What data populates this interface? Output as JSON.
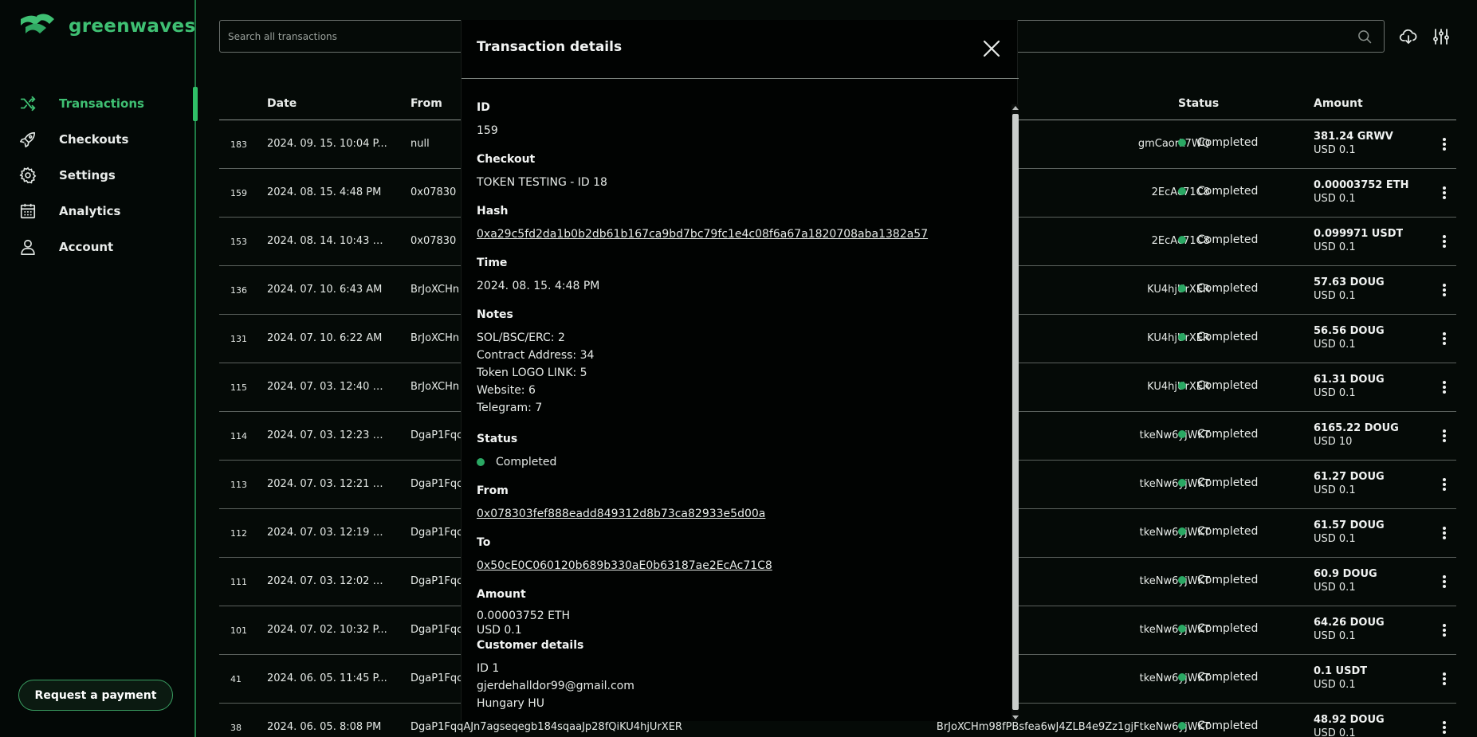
{
  "brand": {
    "name": "greenwaves"
  },
  "sidebar": {
    "items": [
      {
        "label": "Transactions",
        "icon": "shuffle-icon",
        "active": true
      },
      {
        "label": "Checkouts",
        "icon": "rocket-icon"
      },
      {
        "label": "Settings",
        "icon": "gear-icon"
      },
      {
        "label": "Analytics",
        "icon": "calendar-icon"
      },
      {
        "label": "Account",
        "icon": "user-icon"
      }
    ],
    "request_button": "Request a payment"
  },
  "search": {
    "placeholder": "Search all transactions"
  },
  "table": {
    "headers": {
      "date": "Date",
      "from": "From",
      "status": "Status",
      "amount": "Amount"
    },
    "rows": [
      {
        "id": "183",
        "date": "2024. 09. 15. 10:04 P...",
        "from": "null",
        "to": "gmCaork7WQ",
        "status": "Completed",
        "amount": "381.24 GRWV",
        "usd": "USD 0.1"
      },
      {
        "id": "159",
        "date": "2024. 08. 15. 4:48 PM",
        "from": "0x07830",
        "to": "2EcAc71C8",
        "status": "Completed",
        "amount": "0.00003752 ETH",
        "usd": "USD 0.1"
      },
      {
        "id": "153",
        "date": "2024. 08. 14. 10:43 A...",
        "from": "0x07830",
        "to": "2EcAc71C8",
        "status": "Completed",
        "amount": "0.099971 USDT",
        "usd": "USD 0.1"
      },
      {
        "id": "136",
        "date": "2024. 07. 10. 6:43 AM",
        "from": "BrJoXCHn",
        "to": "KU4hjUrXER",
        "status": "Completed",
        "amount": "57.63 DOUG",
        "usd": "USD 0.1"
      },
      {
        "id": "131",
        "date": "2024. 07. 10. 6:22 AM",
        "from": "BrJoXCHn",
        "to": "KU4hjUrXER",
        "status": "Completed",
        "amount": "56.56 DOUG",
        "usd": "USD 0.1"
      },
      {
        "id": "115",
        "date": "2024. 07. 03. 12:40 A...",
        "from": "BrJoXCHn",
        "to": "KU4hjUrXER",
        "status": "Completed",
        "amount": "61.31 DOUG",
        "usd": "USD 0.1"
      },
      {
        "id": "114",
        "date": "2024. 07. 03. 12:23 A...",
        "from": "DgaP1Fqc",
        "to": "tkeNw6yjWKT",
        "status": "Completed",
        "amount": "6165.22 DOUG",
        "usd": "USD 10"
      },
      {
        "id": "113",
        "date": "2024. 07. 03. 12:21 A...",
        "from": "DgaP1Fqc",
        "to": "tkeNw6yjWKT",
        "status": "Completed",
        "amount": "61.27 DOUG",
        "usd": "USD 0.1"
      },
      {
        "id": "112",
        "date": "2024. 07. 03. 12:19 A...",
        "from": "DgaP1Fqc",
        "to": "tkeNw6yjWKT",
        "status": "Completed",
        "amount": "61.57 DOUG",
        "usd": "USD 0.1"
      },
      {
        "id": "111",
        "date": "2024. 07. 03. 12:02 A...",
        "from": "DgaP1Fqc",
        "to": "tkeNw6yjWKT",
        "status": "Completed",
        "amount": "60.9 DOUG",
        "usd": "USD 0.1"
      },
      {
        "id": "101",
        "date": "2024. 07. 02. 10:32 P...",
        "from": "DgaP1Fqc",
        "to": "tkeNw6yjWKT",
        "status": "Completed",
        "amount": "64.26 DOUG",
        "usd": "USD 0.1"
      },
      {
        "id": "41",
        "date": "2024. 06. 05. 11:45 P...",
        "from": "DgaP1Fqc",
        "to": "tkeNw6yjWKT",
        "status": "Completed",
        "amount": "0.1 USDT",
        "usd": "USD 0.1"
      },
      {
        "id": "38",
        "date": "2024. 06. 05. 8:08 PM",
        "from": "DgaP1FqqAJn7agseqegb184sqaaJp28fQiKU4hjUrXER",
        "to": "BrJoXCHm98fPBsfea6wJ4ZLB4e9Zz1gjFtkeNw6yjWKT",
        "status": "Completed",
        "amount": "48.92 DOUG",
        "usd": "USD 0.1"
      }
    ]
  },
  "modal": {
    "title": "Transaction details",
    "id_label": "ID",
    "id": "159",
    "checkout_label": "Checkout",
    "checkout": "TOKEN TESTING - ID 18",
    "hash_label": "Hash",
    "hash": "0xa29c5fd2da1b0b2db61b167ca9bd7bc79fc1e4c08f6a67a1820708aba1382a57",
    "time_label": "Time",
    "time": "2024. 08. 15. 4:48 PM",
    "notes_label": "Notes",
    "notes": [
      "SOL/BSC/ERC: 2",
      "Contract Address: 34",
      "Token LOGO LINK: 5",
      "Website: 6",
      "Telegram: 7"
    ],
    "status_label": "Status",
    "status": "Completed",
    "from_label": "From",
    "from": "0x078303fef888eadd849312d8b73ca82933e5d00a",
    "to_label": "To",
    "to": "0x50cE0C060120b689b330aE0b63187ae2EcAc71C8",
    "amount_label": "Amount",
    "amount": "0.00003752 ETH",
    "amount_usd": "USD 0.1",
    "customer_label": "Customer details",
    "customer_id": "ID 1",
    "customer_email": "gjerdehalldor99@gmail.com",
    "customer_country": "Hungary HU"
  },
  "colors": {
    "accent": "#3fc073",
    "status_dot": "#2aa863",
    "background": "#050a07"
  }
}
